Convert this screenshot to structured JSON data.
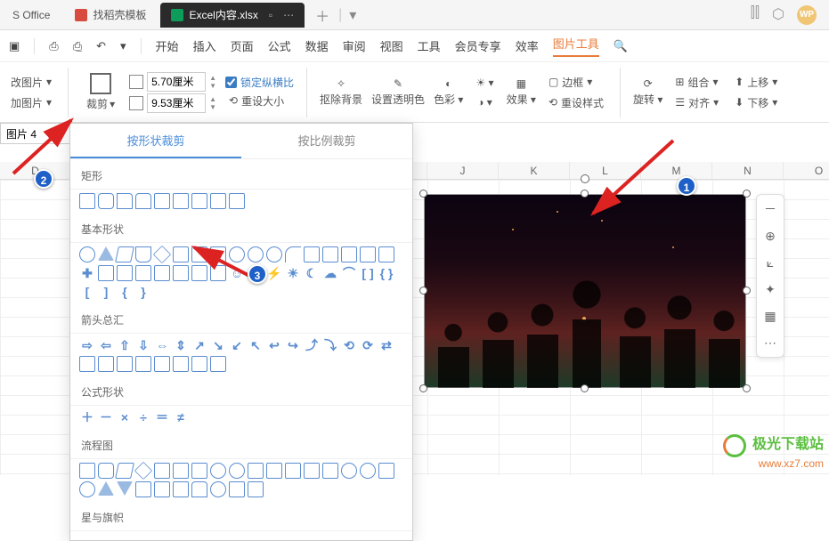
{
  "tabs": {
    "office_label": "S Office",
    "tab1": "找稻壳模板",
    "tab2": "Excel内容.xlsx"
  },
  "menu": {
    "start": "开始",
    "insert": "插入",
    "page": "页面",
    "formula": "公式",
    "data": "数据",
    "review": "审阅",
    "view": "视图",
    "tools": "工具",
    "member": "会员专享",
    "efficiency": "效率",
    "picture_tools": "图片工具"
  },
  "toolbar": {
    "change_pic": "改图片",
    "add_pic": "加图片",
    "crop": "裁剪",
    "height": "5.70厘米",
    "width": "9.53厘米",
    "lock_ratio": "锁定纵横比",
    "reset_size": "重设大小",
    "remove_bg": "抠除背景",
    "set_transparent": "设置透明色",
    "color": "色彩",
    "effect": "效果",
    "border": "边框",
    "reset_style": "重设样式",
    "rotate": "旋转",
    "combine": "组合",
    "align": "对齐",
    "move_up": "上移",
    "move_down": "下移"
  },
  "namebox": "图片 4",
  "columns": [
    "D",
    "",
    "",
    "",
    "",
    "",
    "J",
    "K",
    "L",
    "M",
    "N",
    "O"
  ],
  "dropdown": {
    "tab_shape": "按形状裁剪",
    "tab_ratio": "按比例裁剪",
    "cat_rect": "矩形",
    "cat_basic": "基本形状",
    "cat_arrows": "箭头总汇",
    "cat_formula": "公式形状",
    "cat_flow": "流程图",
    "cat_stars": "星与旗帜"
  },
  "callouts": {
    "c1": "1",
    "c2": "2",
    "c3": "3"
  },
  "watermark": {
    "name": "极光下载站",
    "url": "www.xz7.com"
  }
}
